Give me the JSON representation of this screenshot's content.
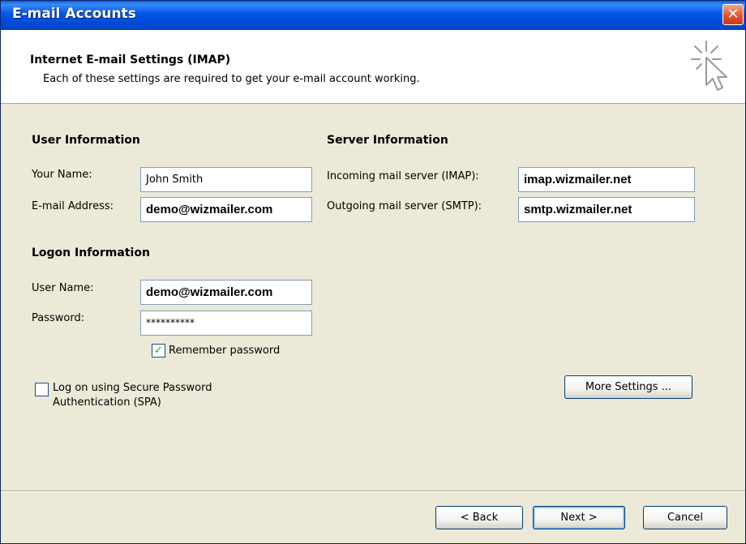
{
  "window": {
    "title": "E-mail Accounts"
  },
  "header": {
    "title": "Internet E-mail Settings (IMAP)",
    "subtitle": "Each of these settings are required to get your e-mail account working."
  },
  "user_info": {
    "heading": "User Information",
    "name_label": "Your Name:",
    "name_value": "John Smith",
    "email_label": "E-mail Address:",
    "email_value": "demo@wizmailer.com"
  },
  "server_info": {
    "heading": "Server Information",
    "incoming_label": "Incoming mail server (IMAP):",
    "incoming_value": "imap.wizmailer.net",
    "outgoing_label": "Outgoing mail server (SMTP):",
    "outgoing_value": "smtp.wizmailer.net"
  },
  "logon_info": {
    "heading": "Logon Information",
    "username_label": "User Name:",
    "username_value": "demo@wizmailer.com",
    "password_label": "Password:",
    "password_value": "**********",
    "remember_label": "Remember password",
    "remember_checked": true
  },
  "spa": {
    "label_line1": "Log on using Secure Password",
    "label_line2": "Authentication (SPA)",
    "checked": false
  },
  "buttons": {
    "more_settings": "More Settings ...",
    "back": "< Back",
    "next": "Next >",
    "cancel": "Cancel"
  },
  "colors": {
    "titlebar": "#0055e5",
    "dialog_bg": "#ece9d8",
    "close_button": "#e2532f",
    "checkmark": "#21a121"
  },
  "icons": [
    "close-icon",
    "cursor-sparkle-icon",
    "checkmark-icon"
  ]
}
